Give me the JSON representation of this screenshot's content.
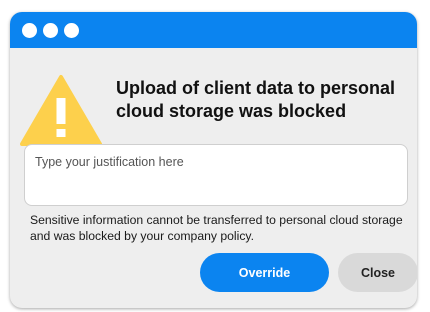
{
  "dialog": {
    "heading": "Upload of client data to personal cloud storage was blocked",
    "justification_placeholder": "Type your justification here",
    "justification_value": "",
    "info_text": "Sensitive information cannot be transferred to personal cloud storage and was blocked by your company policy.",
    "override_label": "Override",
    "close_label": "Close"
  },
  "icons": {
    "warning": "warning-triangle-icon",
    "window_controls": [
      "window-dot-icon",
      "window-dot-icon",
      "window-dot-icon"
    ]
  },
  "colors": {
    "accent": "#0b84f0",
    "warning": "#fdd04c",
    "dialog_bg": "#eeeeee",
    "close_button_bg": "#d9d9d9"
  }
}
